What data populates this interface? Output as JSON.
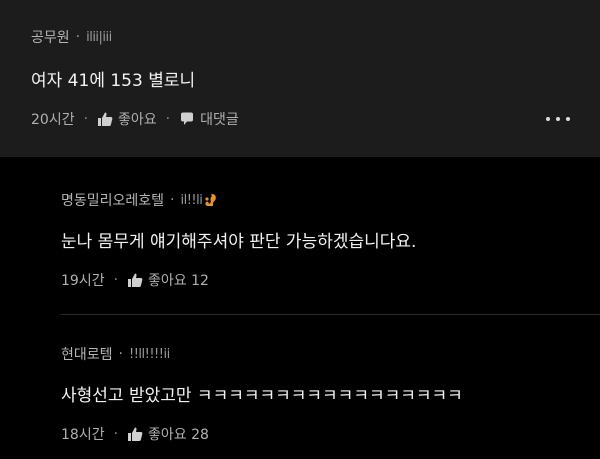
{
  "comments": [
    {
      "author": "공무원",
      "rank": "ilii|iii",
      "text": "여자 41에 153 별로니",
      "time": "20시간",
      "like_label": "좋아요",
      "reply_label": "대댓글",
      "icons": {
        "like": "thumbs-up-icon",
        "reply": "speech-bubble-icon",
        "more": "more-dots-icon"
      }
    }
  ],
  "replies": [
    {
      "author": "명동밀리오레호텔",
      "rank": "il!!li",
      "badge_icon": "squirrel-icon",
      "badge_color": "#e8902a",
      "text": "눈나 몸무게 얘기해주셔야 판단 가능하겠습니다요.",
      "time": "19시간",
      "like_label": "좋아요 12"
    },
    {
      "author": "현대로템",
      "rank": "!!ll!!!!ii",
      "text": "사형선고 받았고만 ㅋㅋㅋㅋㅋㅋㅋㅋㅋㅋㅋㅋㅋㅋㅋㅋㅋ",
      "time": "18시간",
      "like_label": "좋아요 28"
    }
  ],
  "separator": "·"
}
